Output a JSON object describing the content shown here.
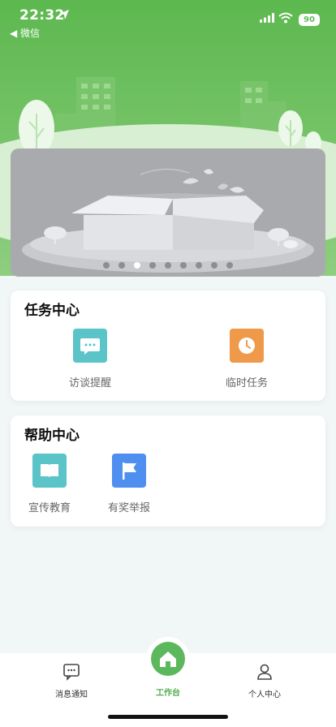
{
  "status_bar": {
    "time": "22:32",
    "back_app": "◀ 微信",
    "battery": "90"
  },
  "banner": {
    "dots": 9,
    "active_dot": 2
  },
  "task_center": {
    "title": "任务中心",
    "items": [
      {
        "label": "访谈提醒",
        "icon": "chat-bubble-icon",
        "color": "#5bc4c9"
      },
      {
        "label": "临时任务",
        "icon": "clock-icon",
        "color": "#ef9a4a"
      }
    ]
  },
  "help_center": {
    "title": "帮助中心",
    "items": [
      {
        "label": "宣传教育",
        "icon": "book-icon",
        "color": "#5bc4c9"
      },
      {
        "label": "有奖举报",
        "icon": "flag-icon",
        "color": "#4e8ff0"
      }
    ]
  },
  "tabbar": {
    "tabs": [
      {
        "label": "消息通知",
        "icon": "message-icon"
      },
      {
        "label": "工作台",
        "icon": "home-icon"
      },
      {
        "label": "个人中心",
        "icon": "person-icon"
      }
    ],
    "active": "工作台",
    "accent": "#5cb85c"
  }
}
